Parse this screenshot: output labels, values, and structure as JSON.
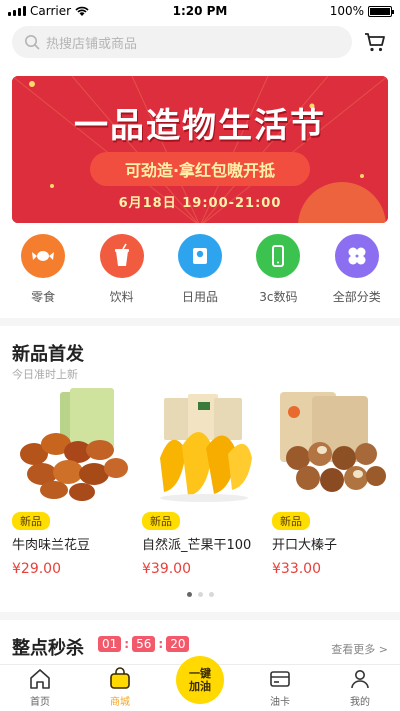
{
  "status": {
    "carrier": "Carrier",
    "time": "1:20 PM",
    "battery": "100%"
  },
  "search": {
    "placeholder": "热搜店铺或商品"
  },
  "banner": {
    "title": "一品造物生活节",
    "subtitle": "可劲造·拿红包嗷开抵",
    "date": "6月18日 19:00-21:00"
  },
  "categories": [
    {
      "label": "零食",
      "icon": "candy-icon",
      "color": "#f57e2e"
    },
    {
      "label": "饮料",
      "icon": "drink-cup-icon",
      "color": "#f15b3f"
    },
    {
      "label": "日用品",
      "icon": "tissue-roll-icon",
      "color": "#2ea4ef"
    },
    {
      "label": "3c数码",
      "icon": "phone-icon",
      "color": "#3cc34f"
    },
    {
      "label": "全部分类",
      "icon": "clover-grid-icon",
      "color": "#8b6ff0"
    }
  ],
  "new_arrivals": {
    "title": "新品首发",
    "subtitle": "今日准时上新",
    "products": [
      {
        "badge": "新品",
        "name": "牛肉味兰花豆",
        "price": "¥29.00"
      },
      {
        "badge": "新品",
        "name": "自然派_芒果干100",
        "price": "¥39.00"
      },
      {
        "badge": "新品",
        "name": "开口大榛子",
        "price": "¥33.00"
      }
    ]
  },
  "flash_sale": {
    "title": "整点秒杀",
    "timer": [
      "01",
      "56",
      "20"
    ],
    "more": "查看更多 >"
  },
  "tabbar": {
    "home": "首页",
    "mall": "商城",
    "center_line1": "一键",
    "center_line2": "加油",
    "card": "油卡",
    "mine": "我的"
  },
  "colors": {
    "accent": "#ffd900",
    "price": "#e8403b",
    "banner": "#dd2e3e"
  }
}
